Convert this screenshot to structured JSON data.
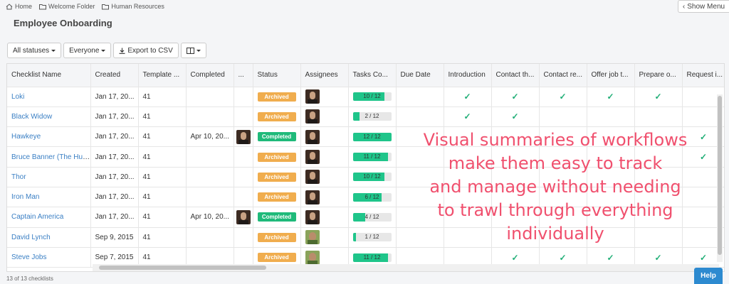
{
  "breadcrumb": [
    {
      "label": "Home",
      "icon": "home-icon"
    },
    {
      "label": "Welcome Folder",
      "icon": "folder-icon"
    },
    {
      "label": "Human Resources",
      "icon": "folder-icon"
    }
  ],
  "show_menu_label": "Show Menu",
  "page_title": "Employee Onboarding",
  "toolbar": {
    "statuses_label": "All statuses",
    "assignee_label": "Everyone",
    "export_label": "Export to CSV",
    "columns_icon": "columns-icon"
  },
  "columns": [
    "Checklist Name",
    "Created",
    "Template ...",
    "Completed",
    "...",
    "Status",
    "Assignees",
    "Tasks Co...",
    "Due Date",
    "Introduction",
    "Contact th...",
    "Contact re...",
    "Offer job t...",
    "Prepare o...",
    "Request i..."
  ],
  "rows": [
    {
      "name": "Loki",
      "created": "Jan 17, 20...",
      "template": "41",
      "completed": "",
      "completed_by": false,
      "status": "Archived",
      "assignee": "a1",
      "tasks": "10 / 12",
      "tasks_progress": 0.833,
      "checks": [
        true,
        true,
        true,
        true,
        true,
        false
      ]
    },
    {
      "name": "Black Widow",
      "created": "Jan 17, 20...",
      "template": "41",
      "completed": "",
      "completed_by": false,
      "status": "Archived",
      "assignee": "a1",
      "tasks": "2 / 12",
      "tasks_progress": 0.167,
      "checks": [
        true,
        true,
        false,
        false,
        false,
        false
      ]
    },
    {
      "name": "Hawkeye",
      "created": "Jan 17, 20...",
      "template": "41",
      "completed": "Apr 10, 20...",
      "completed_by": true,
      "status": "Completed",
      "assignee": "a1",
      "tasks": "12 / 12",
      "tasks_progress": 1.0,
      "checks": [
        false,
        false,
        false,
        false,
        false,
        true
      ]
    },
    {
      "name": "Bruce Banner (The Hulk)",
      "created": "Jan 17, 20...",
      "template": "41",
      "completed": "",
      "completed_by": false,
      "status": "Archived",
      "assignee": "a1",
      "tasks": "11 / 12",
      "tasks_progress": 0.917,
      "checks": [
        false,
        false,
        false,
        false,
        false,
        true
      ]
    },
    {
      "name": "Thor",
      "created": "Jan 17, 20...",
      "template": "41",
      "completed": "",
      "completed_by": false,
      "status": "Archived",
      "assignee": "a1",
      "tasks": "10 / 12",
      "tasks_progress": 0.833,
      "checks": [
        false,
        false,
        false,
        false,
        false,
        false
      ]
    },
    {
      "name": "Iron Man",
      "created": "Jan 17, 20...",
      "template": "41",
      "completed": "",
      "completed_by": false,
      "status": "Archived",
      "assignee": "a1",
      "tasks": "6 / 12",
      "tasks_progress": 0.75,
      "checks": [
        false,
        false,
        false,
        false,
        false,
        false
      ]
    },
    {
      "name": "Captain America",
      "created": "Jan 17, 20...",
      "template": "41",
      "completed": "Apr 10, 20...",
      "completed_by": true,
      "status": "Completed",
      "assignee": "a1",
      "tasks": "4 / 12",
      "tasks_progress": 0.333,
      "checks": [
        false,
        false,
        false,
        false,
        false,
        false
      ]
    },
    {
      "name": "David Lynch",
      "created": "Sep 9, 2015",
      "template": "41",
      "completed": "",
      "completed_by": false,
      "status": "Archived",
      "assignee": "a2",
      "tasks": "1 / 12",
      "tasks_progress": 0.083,
      "checks": [
        false,
        false,
        false,
        false,
        false,
        false
      ]
    },
    {
      "name": "Steve Jobs",
      "created": "Sep 7, 2015",
      "template": "41",
      "completed": "",
      "completed_by": false,
      "status": "Archived",
      "assignee": "a2",
      "tasks": "11 / 12",
      "tasks_progress": 0.917,
      "checks": [
        false,
        true,
        true,
        true,
        true,
        true
      ]
    }
  ],
  "overlay_lines": [
    "Visual summaries of workflows",
    "make them easy to track",
    "and manage without needing",
    "to trawl through everything",
    "individually"
  ],
  "footer_count": "13 of 13 checklists",
  "help_label": "Help",
  "colors": {
    "archived": "#f0ad4e",
    "completed": "#1fba7a",
    "link": "#3a7fc4",
    "overlay": "#f0506e",
    "help": "#2d8ad0"
  }
}
